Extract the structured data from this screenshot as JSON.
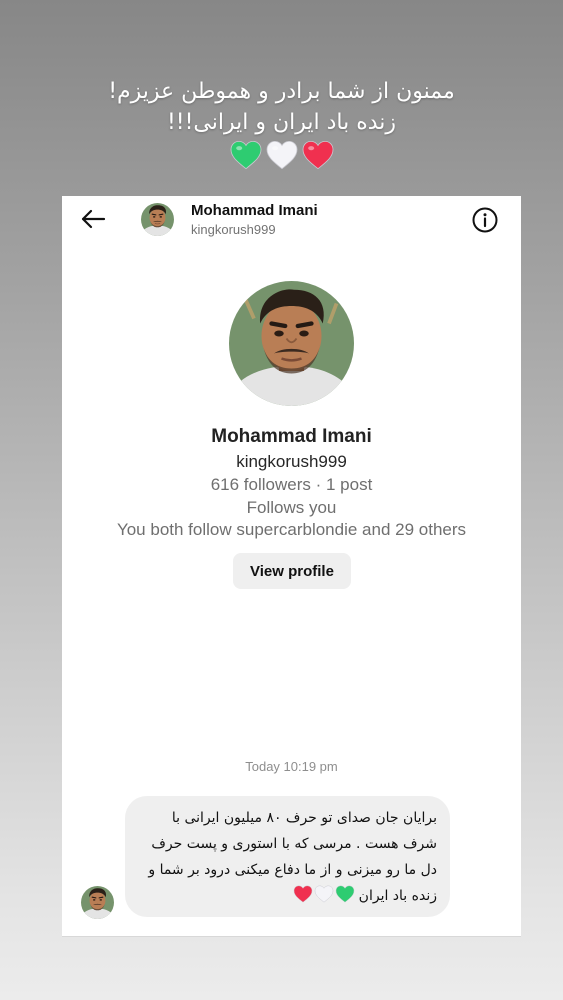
{
  "story_caption": {
    "line1": "ممنون از شما برادر و هموطن عزیزم!",
    "line2": "زنده باد ایران و ایرانی!!!",
    "hearts": [
      {
        "icon": "green-heart-icon",
        "color": "#2ecc71"
      },
      {
        "icon": "white-heart-icon",
        "color": "#f4f4f8"
      },
      {
        "icon": "red-heart-icon",
        "color": "#f0304f"
      }
    ]
  },
  "header": {
    "name": "Mohammad Imani",
    "username": "kingkorush999",
    "back_icon": "back-arrow-icon",
    "info_icon": "info-icon"
  },
  "profile": {
    "name": "Mohammad Imani",
    "username": "kingkorush999",
    "stats": "616 followers · 1 post",
    "follows_you": "Follows you",
    "mutual": "You both follow supercarblondie and 29 others",
    "view_profile_label": "View profile"
  },
  "thread": {
    "timestamp": "Today 10:19 pm",
    "message": {
      "text": "برایان جان صدای تو حرف ۸۰ میلیون ایرانی با شرف هست . مرسی که با استوری و پست حرف دل ما رو میزنی و از ما دفاع میکنی درود بر شما و زنده باد ایران",
      "hearts": [
        {
          "icon": "red-heart-icon",
          "color": "#f0304f"
        },
        {
          "icon": "white-heart-icon",
          "color": "#f4f4f8"
        },
        {
          "icon": "green-heart-icon",
          "color": "#2ecc71"
        }
      ]
    }
  },
  "colors": {
    "card_bg": "#ffffff",
    "button_bg": "#efefef",
    "bubble_bg": "#efefef",
    "muted_text": "#737373"
  }
}
